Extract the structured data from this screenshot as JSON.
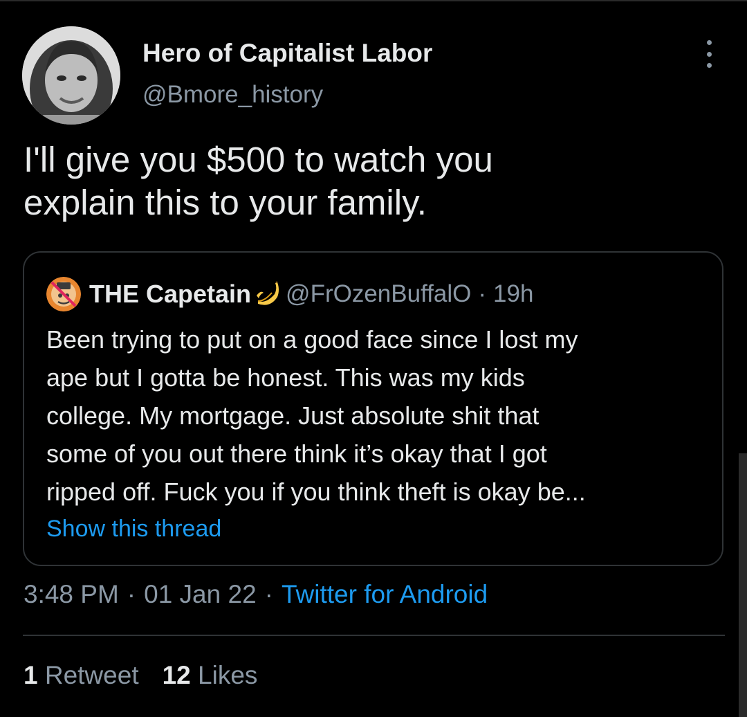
{
  "tweet": {
    "author_name": "Hero of Capitalist Labor",
    "author_handle": "@Bmore_history",
    "text_lines": [
      "I'll give you $500 to watch you",
      "explain this to your family."
    ],
    "timestamp_time": "3:48 PM",
    "timestamp_date": "01 Jan 22",
    "separator": "·",
    "client": "Twitter for Android",
    "retweet_count": "1",
    "retweet_label": "Retweet",
    "like_count": "12",
    "like_label": "Likes"
  },
  "quoted_tweet": {
    "author_name": "THE Capetain",
    "author_emoji": "banana-icon",
    "author_handle": "@FrOzenBuffalO",
    "separator": "·",
    "time": "19h",
    "text_lines": [
      "Been trying to put on a good face since I lost my",
      "ape but I gotta be honest. This was my kids",
      "college. My mortgage. Just absolute shit that",
      "some of you out there think it’s okay that I got",
      "ripped off. Fuck you if you think theft is okay be..."
    ],
    "show_thread_label": "Show this thread"
  },
  "colors": {
    "background": "#000000",
    "text_primary": "#e7e9ea",
    "text_secondary": "#8b98a5",
    "link": "#1d9bf0",
    "border": "#2f3336"
  }
}
